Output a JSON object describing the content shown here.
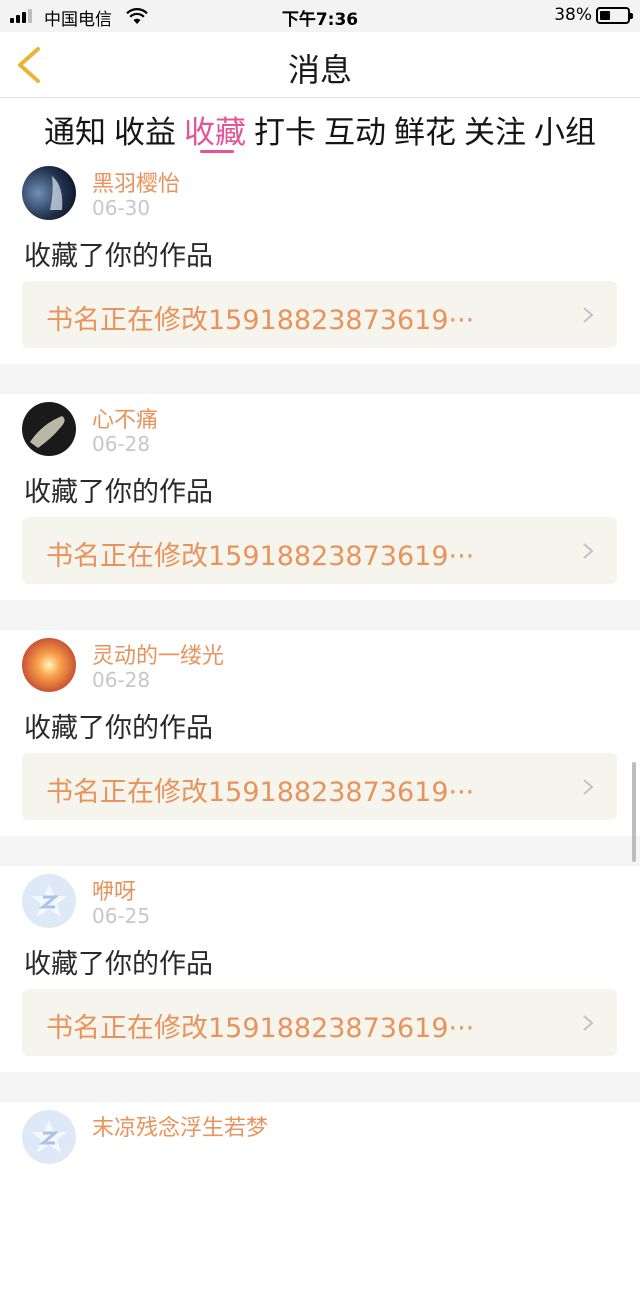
{
  "status": {
    "carrier": "中国电信",
    "time": "下午7:36",
    "battery": "38%",
    "battery_level": 0.38
  },
  "nav": {
    "title": "消息",
    "back_icon": "chevron-left-icon"
  },
  "tabs": [
    {
      "label": "通知",
      "active": false
    },
    {
      "label": "收益",
      "active": false
    },
    {
      "label": "收藏",
      "active": true
    },
    {
      "label": "打卡",
      "active": false
    },
    {
      "label": "互动",
      "active": false
    },
    {
      "label": "鲜花",
      "active": false
    },
    {
      "label": "关注",
      "active": false
    },
    {
      "label": "小组",
      "active": false
    }
  ],
  "feed": [
    {
      "user": "黑羽樱怡",
      "date": "06-30",
      "action": "收藏了你的作品",
      "work": "书名正在修改15918823873619···",
      "avatar": "avatar-dark-landscape"
    },
    {
      "user": "心不痛",
      "date": "06-28",
      "action": "收藏了你的作品",
      "work": "书名正在修改15918823873619···",
      "avatar": "avatar-dark-hand"
    },
    {
      "user": "灵动的一缕光",
      "date": "06-28",
      "action": "收藏了你的作品",
      "work": "书名正在修改15918823873619···",
      "avatar": "avatar-sunburst"
    },
    {
      "user": "咿呀",
      "date": "06-25",
      "action": "收藏了你的作品",
      "work": "书名正在修改15918823873619···",
      "avatar": "avatar-default-z"
    },
    {
      "user": "末凉残念浮生若梦",
      "date": "",
      "action": "",
      "work": "",
      "avatar": "avatar-default-z"
    }
  ],
  "colors": {
    "accent": "#e25597",
    "username": "#e8935c",
    "work_box_bg": "#f5f5ee",
    "back_arrow": "#e8b630"
  }
}
